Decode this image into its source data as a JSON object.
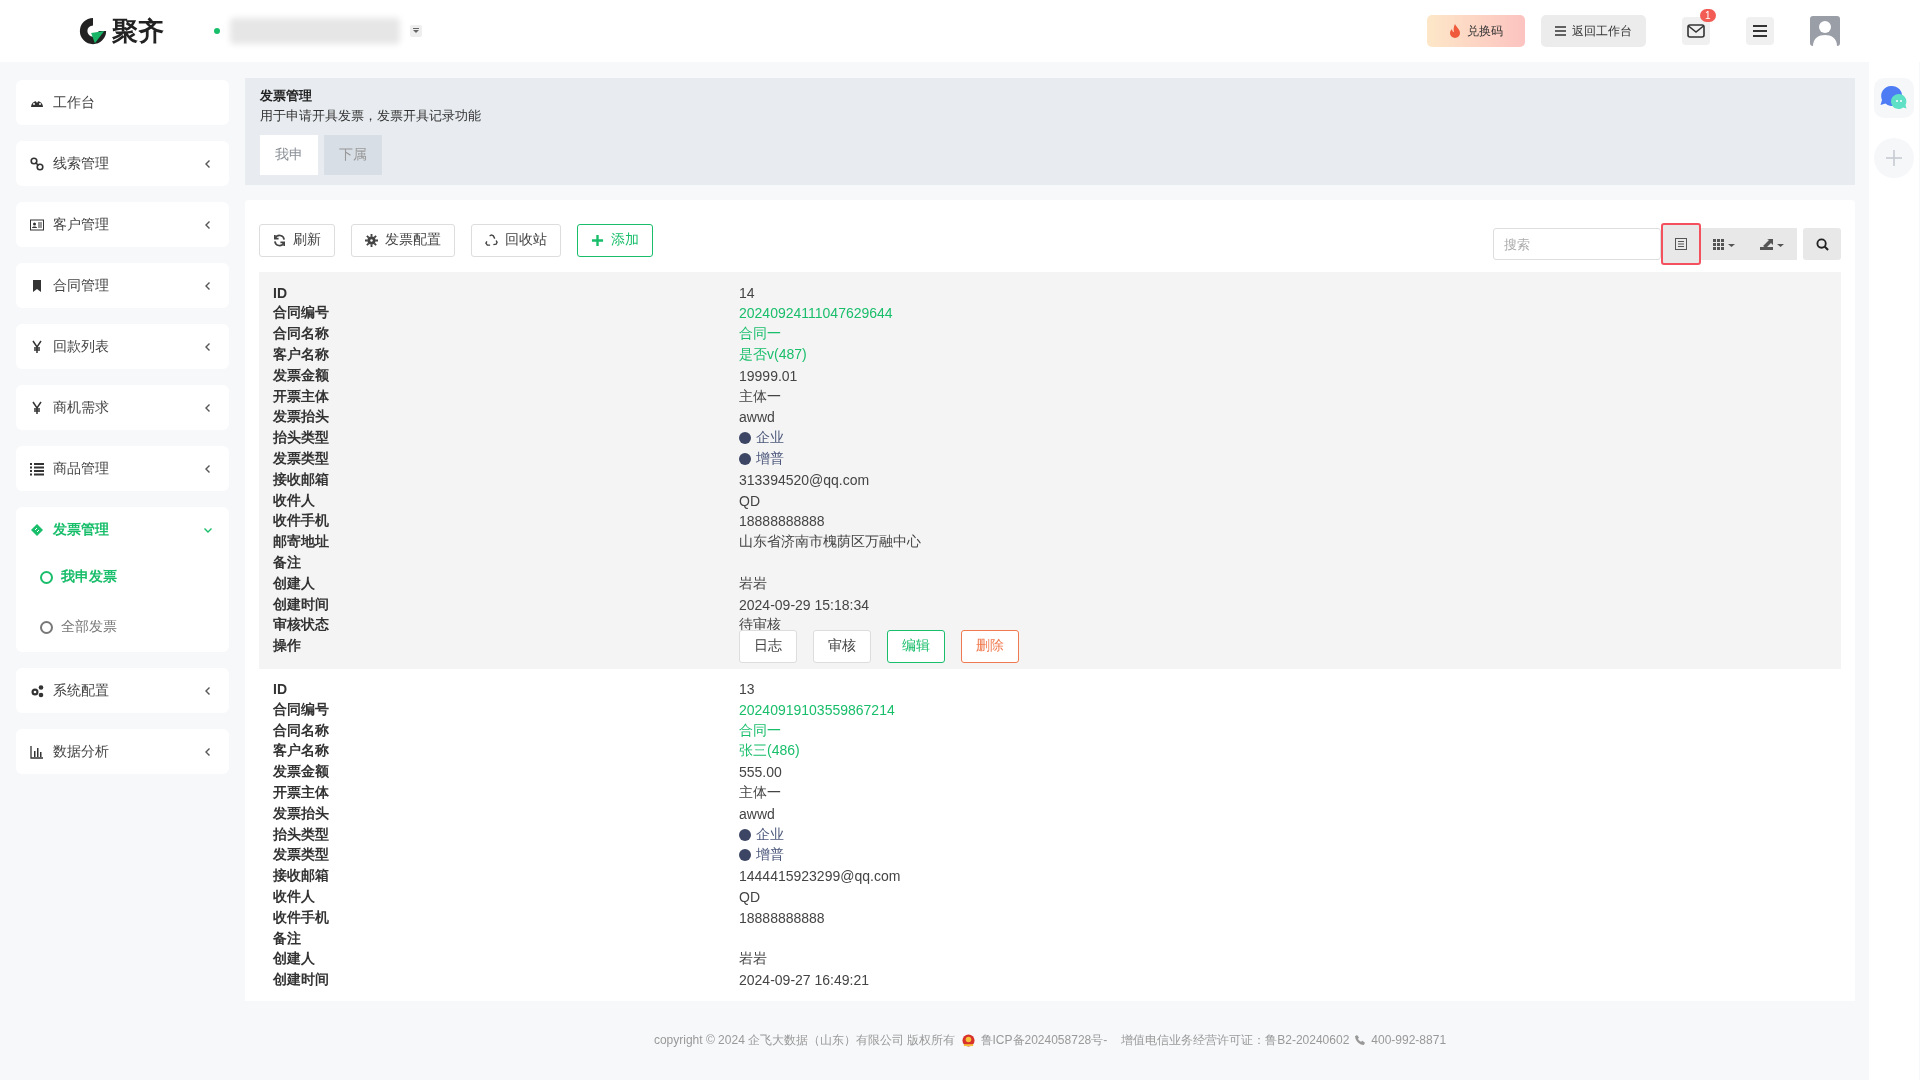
{
  "header": {
    "logo": "聚齐",
    "status_online": true,
    "redeem_button": "兑换码",
    "back_button": "返回工作台",
    "mail_badge": "1"
  },
  "sidebar": {
    "items": [
      {
        "label": "工作台",
        "selected": false
      },
      {
        "label": "线索管理",
        "expanded": false,
        "selected": false
      },
      {
        "label": "客户管理",
        "expanded": false,
        "selected": false
      },
      {
        "label": "合同管理",
        "expanded": false,
        "selected": false
      },
      {
        "label": "回款列表",
        "expanded": false,
        "selected": false
      },
      {
        "label": "商机需求",
        "expanded": false,
        "selected": false
      },
      {
        "label": "商品管理",
        "expanded": false,
        "selected": false
      },
      {
        "label": "发票管理",
        "expanded": true,
        "selected": true,
        "children": [
          {
            "label": "我申发票",
            "selected": true
          },
          {
            "label": "全部发票",
            "selected": false
          }
        ]
      },
      {
        "label": "系统配置",
        "expanded": false,
        "selected": false
      },
      {
        "label": "数据分析",
        "expanded": false,
        "selected": false
      }
    ]
  },
  "page": {
    "title": "发票管理",
    "description": "用于申请开具发票，发票开具记录功能",
    "tabs": [
      {
        "label": "我申",
        "selected": true
      },
      {
        "label": "下属",
        "selected": false
      }
    ]
  },
  "toolbar": {
    "buttons": [
      {
        "label": "刷新",
        "kind": "default"
      },
      {
        "label": "发票配置",
        "kind": "default"
      },
      {
        "label": "回收站",
        "kind": "default"
      },
      {
        "label": "添加",
        "kind": "primary"
      }
    ],
    "search": {
      "placeholder": "搜索"
    },
    "view_toggle_highlighted": true
  },
  "records": [
    {
      "rows": [
        {
          "label": "ID",
          "kind": "text",
          "value": "14"
        },
        {
          "label": "合同编号",
          "kind": "link",
          "value": "20240924111047629644"
        },
        {
          "label": "合同名称",
          "kind": "link",
          "value": "合同一"
        },
        {
          "label": "客户名称",
          "kind": "link",
          "value": "是否v(487)"
        },
        {
          "label": "发票金额",
          "kind": "text",
          "value": "19999.01"
        },
        {
          "label": "开票主体",
          "kind": "text",
          "value": "主体一"
        },
        {
          "label": "发票抬头",
          "kind": "text",
          "value": "awwd"
        },
        {
          "label": "抬头类型",
          "kind": "dot",
          "value": "企业",
          "color": "#3c4664"
        },
        {
          "label": "发票类型",
          "kind": "dot",
          "value": "增普",
          "color": "#3c4664"
        },
        {
          "label": "接收邮箱",
          "kind": "text",
          "value": "313394520@qq.com"
        },
        {
          "label": "收件人",
          "kind": "text",
          "value": "QD"
        },
        {
          "label": "收件手机",
          "kind": "text",
          "value": "18888888888"
        },
        {
          "label": "邮寄地址",
          "kind": "text",
          "value": "山东省济南市槐荫区万融中心"
        },
        {
          "label": "备注",
          "kind": "text"
        },
        {
          "label": "创建人",
          "kind": "text",
          "value": "岩岩"
        },
        {
          "label": "创建时间",
          "kind": "text",
          "value": "2024-09-29 15:18:34"
        },
        {
          "label": "审核状态",
          "kind": "text",
          "value": "待审核"
        },
        {
          "label": "操作",
          "kind": "actions",
          "actions": [
            {
              "label": "日志",
              "kind": "default"
            },
            {
              "label": "审核",
              "kind": "default"
            },
            {
              "label": "编辑",
              "kind": "primary"
            },
            {
              "label": "删除",
              "kind": "danger"
            }
          ]
        }
      ]
    },
    {
      "rows": [
        {
          "label": "ID",
          "kind": "text",
          "value": "13"
        },
        {
          "label": "合同编号",
          "kind": "link",
          "value": "20240919103559867214"
        },
        {
          "label": "合同名称",
          "kind": "link",
          "value": "合同一"
        },
        {
          "label": "客户名称",
          "kind": "link",
          "value": "张三(486)"
        },
        {
          "label": "发票金额",
          "kind": "text",
          "value": "555.00"
        },
        {
          "label": "开票主体",
          "kind": "text",
          "value": "主体一"
        },
        {
          "label": "发票抬头",
          "kind": "text",
          "value": "awwd"
        },
        {
          "label": "抬头类型",
          "kind": "dot",
          "value": "企业",
          "color": "#3c4664"
        },
        {
          "label": "发票类型",
          "kind": "dot",
          "value": "增普",
          "color": "#3c4664"
        },
        {
          "label": "接收邮箱",
          "kind": "text",
          "value": "1444415923299@qq.com"
        },
        {
          "label": "收件人",
          "kind": "text",
          "value": "QD"
        },
        {
          "label": "收件手机",
          "kind": "text",
          "value": "18888888888"
        },
        {
          "label": "备注",
          "kind": "text"
        },
        {
          "label": "创建人",
          "kind": "text",
          "value": "岩岩"
        },
        {
          "label": "创建时间",
          "kind": "text",
          "value": "2024-09-27 16:49:21"
        }
      ]
    }
  ],
  "footer": {
    "copyright": "copyright © 2024 企飞大数据（山东）有限公司 版权所有",
    "icp": "鲁ICP备2024058728号-",
    "license": "增值电信业务经营许可证：鲁B2-20240602",
    "phone": "400-992-8871"
  }
}
